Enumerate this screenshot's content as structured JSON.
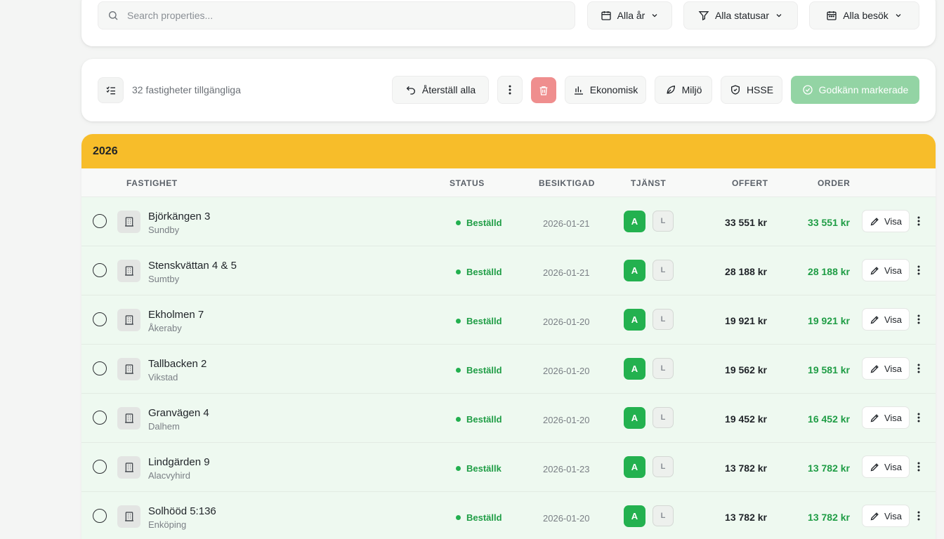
{
  "filters": {
    "search_placeholder": "Search properties...",
    "year": "Alla år",
    "status": "Alla statusar",
    "visits": "Alla besök"
  },
  "toolbar": {
    "available_text": "32 fastigheter tillgängliga",
    "reset_label": "Återställ alla",
    "ekonomisk_label": "Ekonomisk",
    "miljo_label": "Miljö",
    "hsse_label": "HSSE",
    "approve_label": "Godkänn markerade"
  },
  "group": {
    "year": "2026",
    "color": "#f7bd2a"
  },
  "columns": {
    "fastighet": "FASTIGHET",
    "status": "STATUS",
    "besiktigad": "BESIKTIGAD",
    "tjanst": "TJÄNST",
    "offert": "OFFERT",
    "order": "ORDER"
  },
  "rows": [
    {
      "name": "Björkängen 3",
      "city": "Sundby",
      "status": "Beställd",
      "date": "2026-01-21",
      "tjanst_a": "A",
      "tjanst_l": "L",
      "offert": "33 551 kr",
      "order": "33 551 kr",
      "visa": "Visa"
    },
    {
      "name": "Stenskvättan 4 & 5",
      "city": "Sumtby",
      "status": "Beställd",
      "date": "2026-01-21",
      "tjanst_a": "A",
      "tjanst_l": "L",
      "offert": "28 188 kr",
      "order": "28 188 kr",
      "visa": "Visa"
    },
    {
      "name": "Ekholmen 7",
      "city": "Åkeraby",
      "status": "Beställd",
      "date": "2026-01-20",
      "tjanst_a": "A",
      "tjanst_l": "L",
      "offert": "19 921 kr",
      "order": "19 921 kr",
      "visa": "Visa"
    },
    {
      "name": "Tallbacken 2",
      "city": "Vikstad",
      "status": "Beställd",
      "date": "2026-01-20",
      "tjanst_a": "A",
      "tjanst_l": "L",
      "offert": "19 562 kr",
      "order": "19 581 kr",
      "visa": "Visa"
    },
    {
      "name": "Granvägen 4",
      "city": "Dalhem",
      "status": "Beställd",
      "date": "2026-01-20",
      "tjanst_a": "A",
      "tjanst_l": "L",
      "offert": "19 452 kr",
      "order": "16 452 kr",
      "visa": "Visa"
    },
    {
      "name": "Lindgärden 9",
      "city": "Alacvyhird",
      "status": "Beställk",
      "date": "2026-01-23",
      "tjanst_a": "A",
      "tjanst_l": "L",
      "offert": "13 782 kr",
      "order": "13 782 kr",
      "visa": "Visa"
    },
    {
      "name": "Solhööd 5:136",
      "city": "Enköping",
      "status": "Beställd",
      "date": "2026-01-20",
      "tjanst_a": "A",
      "tjanst_l": "L",
      "offert": "13 782 kr",
      "order": "13 782 kr",
      "visa": "Visa"
    }
  ]
}
